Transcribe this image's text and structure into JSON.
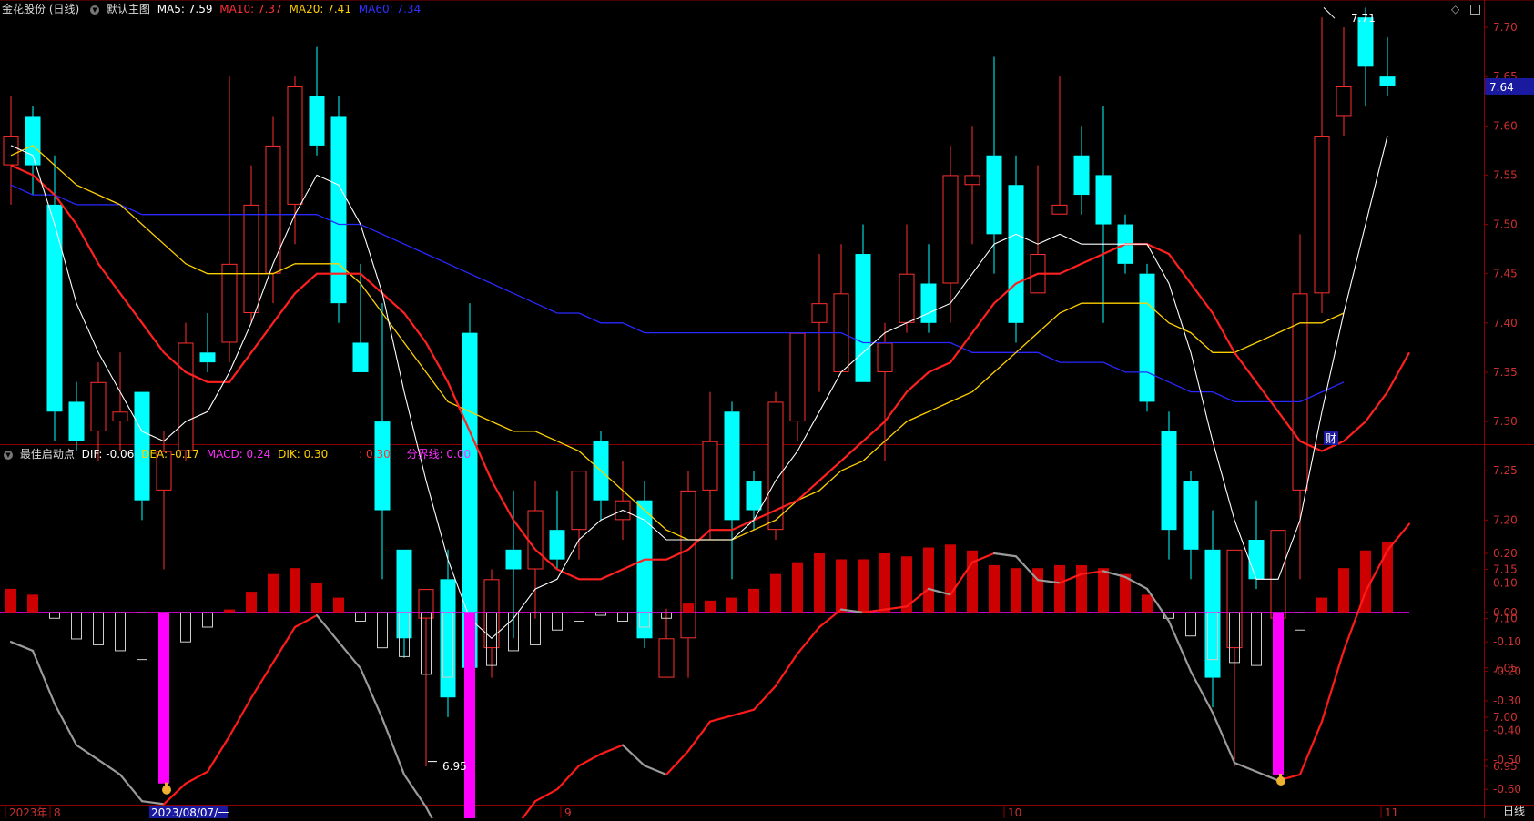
{
  "header": {
    "stock": "金花股份 (日线)",
    "theme": "默认主图",
    "ma": [
      {
        "label": "MA5: 7.59",
        "color": "#ffffff"
      },
      {
        "label": "MA10: 7.37",
        "color": "#ff3030"
      },
      {
        "label": "MA20: 7.41",
        "color": "#ffd000"
      },
      {
        "label": "MA60: 7.34",
        "color": "#3030ff"
      }
    ]
  },
  "indicator_header": {
    "name": "最佳启动点",
    "items": [
      {
        "label": "DIF: -0.06",
        "color": "#ffffff"
      },
      {
        "label": "DEA: -0.17",
        "color": "#ffd000"
      },
      {
        "label": "MACD: 0.24",
        "color": "#ff30ff"
      },
      {
        "label": "DIK: 0.30",
        "color": "#ffd000"
      },
      {
        "label": ": 0.30",
        "color": "#ff3030"
      },
      {
        "label": "分界线: 0.00",
        "color": "#ff30ff"
      }
    ]
  },
  "price_axis": [
    "7.70",
    "7.65",
    "7.60",
    "7.55",
    "7.50",
    "7.45",
    "7.40",
    "7.35",
    "7.30",
    "7.25",
    "7.20",
    "7.15",
    "7.10",
    "7.05",
    "7.00",
    "6.95"
  ],
  "indicator_axis": [
    "0.20",
    "0.10",
    "0.00",
    "-0.10",
    "-0.20",
    "-0.30",
    "-0.40",
    "-0.50",
    "-0.60"
  ],
  "current_price": "7.64",
  "high_label": "7.71",
  "low_label": "6.95",
  "finance_marker": "财",
  "time_axis": [
    "2023年",
    "8",
    "2023/08/07/一",
    "9",
    "10",
    "11"
  ],
  "period_button": "日线",
  "colors": {
    "up": "#ff3030",
    "down": "#00ffff",
    "ma5": "#ffffff",
    "ma10": "#ff2020",
    "ma20": "#ffd000",
    "ma60": "#2828ff",
    "macd_pos": "#cc0000",
    "macd_neg": "#ffffff",
    "signal": "#ff00ff"
  },
  "chart_data": {
    "type": "candlestick",
    "candles": [
      {
        "o": 7.56,
        "h": 7.63,
        "l": 7.52,
        "c": 7.59
      },
      {
        "o": 7.61,
        "h": 7.62,
        "l": 7.53,
        "c": 7.56
      },
      {
        "o": 7.52,
        "h": 7.57,
        "l": 7.28,
        "c": 7.31
      },
      {
        "o": 7.32,
        "h": 7.34,
        "l": 7.27,
        "c": 7.28
      },
      {
        "o": 7.29,
        "h": 7.36,
        "l": 7.26,
        "c": 7.34
      },
      {
        "o": 7.3,
        "h": 7.37,
        "l": 7.27,
        "c": 7.31
      },
      {
        "o": 7.33,
        "h": 7.33,
        "l": 7.2,
        "c": 7.22
      },
      {
        "o": 7.23,
        "h": 7.29,
        "l": 7.15,
        "c": 7.27
      },
      {
        "o": 7.27,
        "h": 7.4,
        "l": 7.26,
        "c": 7.38
      },
      {
        "o": 7.37,
        "h": 7.41,
        "l": 7.35,
        "c": 7.36
      },
      {
        "o": 7.38,
        "h": 7.65,
        "l": 7.36,
        "c": 7.46
      },
      {
        "o": 7.41,
        "h": 7.56,
        "l": 7.4,
        "c": 7.52
      },
      {
        "o": 7.45,
        "h": 7.61,
        "l": 7.42,
        "c": 7.58
      },
      {
        "o": 7.52,
        "h": 7.65,
        "l": 7.48,
        "c": 7.64
      },
      {
        "o": 7.63,
        "h": 7.68,
        "l": 7.57,
        "c": 7.58
      },
      {
        "o": 7.61,
        "h": 7.63,
        "l": 7.4,
        "c": 7.42
      },
      {
        "o": 7.38,
        "h": 7.46,
        "l": 7.35,
        "c": 7.35
      },
      {
        "o": 7.3,
        "h": 7.42,
        "l": 7.14,
        "c": 7.21
      },
      {
        "o": 7.17,
        "h": 7.17,
        "l": 7.06,
        "c": 7.08
      },
      {
        "o": 7.1,
        "h": 7.13,
        "l": 6.95,
        "c": 7.13
      },
      {
        "o": 7.14,
        "h": 7.17,
        "l": 7.0,
        "c": 7.02
      },
      {
        "o": 7.39,
        "h": 7.42,
        "l": 7.0,
        "c": 7.05
      },
      {
        "o": 7.07,
        "h": 7.15,
        "l": 7.04,
        "c": 7.14
      },
      {
        "o": 7.17,
        "h": 7.23,
        "l": 7.08,
        "c": 7.15
      },
      {
        "o": 7.15,
        "h": 7.24,
        "l": 7.1,
        "c": 7.21
      },
      {
        "o": 7.19,
        "h": 7.23,
        "l": 7.15,
        "c": 7.16
      },
      {
        "o": 7.19,
        "h": 7.25,
        "l": 7.16,
        "c": 7.25
      },
      {
        "o": 7.28,
        "h": 7.29,
        "l": 7.2,
        "c": 7.22
      },
      {
        "o": 7.2,
        "h": 7.26,
        "l": 7.18,
        "c": 7.22
      },
      {
        "o": 7.22,
        "h": 7.24,
        "l": 7.07,
        "c": 7.08
      },
      {
        "o": 7.04,
        "h": 7.11,
        "l": 7.04,
        "c": 7.08
      },
      {
        "o": 7.08,
        "h": 7.25,
        "l": 7.04,
        "c": 7.23
      },
      {
        "o": 7.23,
        "h": 7.33,
        "l": 7.18,
        "c": 7.28
      },
      {
        "o": 7.31,
        "h": 7.32,
        "l": 7.14,
        "c": 7.2
      },
      {
        "o": 7.24,
        "h": 7.25,
        "l": 7.19,
        "c": 7.21
      },
      {
        "o": 7.19,
        "h": 7.33,
        "l": 7.18,
        "c": 7.32
      },
      {
        "o": 7.3,
        "h": 7.39,
        "l": 7.28,
        "c": 7.39
      },
      {
        "o": 7.4,
        "h": 7.47,
        "l": 7.33,
        "c": 7.42
      },
      {
        "o": 7.35,
        "h": 7.48,
        "l": 7.36,
        "c": 7.43
      },
      {
        "o": 7.47,
        "h": 7.5,
        "l": 7.34,
        "c": 7.34
      },
      {
        "o": 7.35,
        "h": 7.4,
        "l": 7.26,
        "c": 7.38
      },
      {
        "o": 7.4,
        "h": 7.5,
        "l": 7.39,
        "c": 7.45
      },
      {
        "o": 7.44,
        "h": 7.48,
        "l": 7.39,
        "c": 7.4
      },
      {
        "o": 7.44,
        "h": 7.58,
        "l": 7.4,
        "c": 7.55
      },
      {
        "o": 7.54,
        "h": 7.6,
        "l": 7.48,
        "c": 7.55
      },
      {
        "o": 7.57,
        "h": 7.67,
        "l": 7.45,
        "c": 7.49
      },
      {
        "o": 7.54,
        "h": 7.57,
        "l": 7.38,
        "c": 7.4
      },
      {
        "o": 7.43,
        "h": 7.56,
        "l": 7.43,
        "c": 7.47
      },
      {
        "o": 7.51,
        "h": 7.65,
        "l": 7.51,
        "c": 7.52
      },
      {
        "o": 7.57,
        "h": 7.6,
        "l": 7.51,
        "c": 7.53
      },
      {
        "o": 7.55,
        "h": 7.62,
        "l": 7.4,
        "c": 7.5
      },
      {
        "o": 7.5,
        "h": 7.51,
        "l": 7.45,
        "c": 7.46
      },
      {
        "o": 7.45,
        "h": 7.46,
        "l": 7.31,
        "c": 7.32
      },
      {
        "o": 7.29,
        "h": 7.31,
        "l": 7.16,
        "c": 7.19
      },
      {
        "o": 7.24,
        "h": 7.25,
        "l": 7.14,
        "c": 7.17
      },
      {
        "o": 7.17,
        "h": 7.21,
        "l": 7.01,
        "c": 7.04
      },
      {
        "o": 7.07,
        "h": 7.17,
        "l": 6.95,
        "c": 7.17
      },
      {
        "o": 7.18,
        "h": 7.22,
        "l": 7.13,
        "c": 7.14
      },
      {
        "o": 7.1,
        "h": 7.19,
        "l": 7.05,
        "c": 7.19
      },
      {
        "o": 7.23,
        "h": 7.49,
        "l": 7.14,
        "c": 7.43
      },
      {
        "o": 7.43,
        "h": 7.71,
        "l": 7.41,
        "c": 7.59
      },
      {
        "o": 7.61,
        "h": 7.7,
        "l": 7.59,
        "c": 7.64
      },
      {
        "o": 7.71,
        "h": 7.72,
        "l": 7.62,
        "c": 7.66
      },
      {
        "o": 7.65,
        "h": 7.69,
        "l": 7.63,
        "c": 7.64
      }
    ],
    "ma5": [
      7.58,
      7.57,
      7.5,
      7.42,
      7.37,
      7.33,
      7.29,
      7.28,
      7.3,
      7.31,
      7.35,
      7.4,
      7.46,
      7.51,
      7.55,
      7.54,
      7.5,
      7.43,
      7.33,
      7.24,
      7.16,
      7.1,
      7.08,
      7.1,
      7.13,
      7.14,
      7.18,
      7.2,
      7.21,
      7.2,
      7.18,
      7.18,
      7.18,
      7.18,
      7.2,
      7.24,
      7.27,
      7.31,
      7.35,
      7.37,
      7.39,
      7.4,
      7.41,
      7.42,
      7.45,
      7.48,
      7.49,
      7.48,
      7.49,
      7.48,
      7.48,
      7.48,
      7.48,
      7.44,
      7.37,
      7.28,
      7.2,
      7.14,
      7.14,
      7.2,
      7.31,
      7.41,
      7.5,
      7.59
    ],
    "ma10": [
      7.56,
      7.55,
      7.53,
      7.5,
      7.46,
      7.43,
      7.4,
      7.37,
      7.35,
      7.34,
      7.34,
      7.37,
      7.4,
      7.43,
      7.45,
      7.45,
      7.45,
      7.43,
      7.41,
      7.38,
      7.34,
      7.29,
      7.24,
      7.2,
      7.17,
      7.15,
      7.14,
      7.14,
      7.15,
      7.16,
      7.16,
      7.17,
      7.19,
      7.19,
      7.2,
      7.21,
      7.22,
      7.24,
      7.26,
      7.28,
      7.3,
      7.33,
      7.35,
      7.36,
      7.39,
      7.42,
      7.44,
      7.45,
      7.45,
      7.46,
      7.47,
      7.48,
      7.48,
      7.47,
      7.44,
      7.41,
      7.37,
      7.34,
      7.31,
      7.28,
      7.27,
      7.28,
      7.3,
      7.33,
      7.37
    ],
    "ma20": [
      7.57,
      7.58,
      7.56,
      7.54,
      7.53,
      7.52,
      7.5,
      7.48,
      7.46,
      7.45,
      7.45,
      7.45,
      7.45,
      7.46,
      7.46,
      7.46,
      7.44,
      7.41,
      7.38,
      7.35,
      7.32,
      7.31,
      7.3,
      7.29,
      7.29,
      7.28,
      7.27,
      7.25,
      7.23,
      7.21,
      7.19,
      7.18,
      7.18,
      7.18,
      7.19,
      7.2,
      7.22,
      7.23,
      7.25,
      7.26,
      7.28,
      7.3,
      7.31,
      7.32,
      7.33,
      7.35,
      7.37,
      7.39,
      7.41,
      7.42,
      7.42,
      7.42,
      7.42,
      7.4,
      7.39,
      7.37,
      7.37,
      7.38,
      7.39,
      7.4,
      7.4,
      7.41
    ],
    "ma60": [
      7.54,
      7.53,
      7.53,
      7.52,
      7.52,
      7.52,
      7.51,
      7.51,
      7.51,
      7.51,
      7.51,
      7.51,
      7.51,
      7.51,
      7.51,
      7.5,
      7.5,
      7.49,
      7.48,
      7.47,
      7.46,
      7.45,
      7.44,
      7.43,
      7.42,
      7.41,
      7.41,
      7.4,
      7.4,
      7.39,
      7.39,
      7.39,
      7.39,
      7.39,
      7.39,
      7.39,
      7.39,
      7.39,
      7.39,
      7.38,
      7.38,
      7.38,
      7.38,
      7.38,
      7.37,
      7.37,
      7.37,
      7.37,
      7.36,
      7.36,
      7.36,
      7.35,
      7.35,
      7.34,
      7.33,
      7.33,
      7.32,
      7.32,
      7.32,
      7.32,
      7.33,
      7.34
    ],
    "macd": [
      0.08,
      0.06,
      -0.02,
      -0.09,
      -0.11,
      -0.13,
      -0.16,
      -0.58,
      -0.1,
      -0.05,
      0.01,
      0.07,
      0.13,
      0.15,
      0.1,
      0.05,
      -0.03,
      -0.12,
      -0.15,
      -0.21,
      -0.22,
      -0.8,
      -0.18,
      -0.13,
      -0.11,
      -0.06,
      -0.03,
      -0.01,
      -0.03,
      -0.05,
      -0.02,
      0.03,
      0.04,
      0.05,
      0.08,
      0.13,
      0.17,
      0.2,
      0.18,
      0.18,
      0.2,
      0.19,
      0.22,
      0.23,
      0.21,
      0.16,
      0.15,
      0.15,
      0.16,
      0.16,
      0.15,
      0.13,
      0.06,
      -0.02,
      -0.08,
      -0.16,
      -0.17,
      -0.18,
      -0.55,
      -0.06,
      0.05,
      0.15,
      0.21,
      0.24
    ],
    "dif": [
      -0.1,
      -0.13,
      -0.31,
      -0.45,
      -0.5,
      -0.55,
      -0.64,
      -0.65,
      -0.58,
      -0.54,
      -0.42,
      -0.29,
      -0.17,
      -0.05,
      -0.01,
      -0.1,
      -0.19,
      -0.36,
      -0.55,
      -0.66,
      -0.8,
      -0.83,
      -0.8,
      -0.74,
      -0.64,
      -0.6,
      -0.52,
      -0.48,
      -0.45,
      -0.52,
      -0.55,
      -0.47,
      -0.37,
      -0.35,
      -0.33,
      -0.25,
      -0.14,
      -0.05,
      0.01,
      0.0,
      0.01,
      0.02,
      0.08,
      0.06,
      0.17,
      0.2,
      0.19,
      0.11,
      0.1,
      0.13,
      0.14,
      0.12,
      0.08,
      -0.03,
      -0.2,
      -0.34,
      -0.51,
      -0.54,
      -0.57,
      -0.55,
      -0.37,
      -0.13,
      0.07,
      0.21,
      0.3
    ]
  }
}
